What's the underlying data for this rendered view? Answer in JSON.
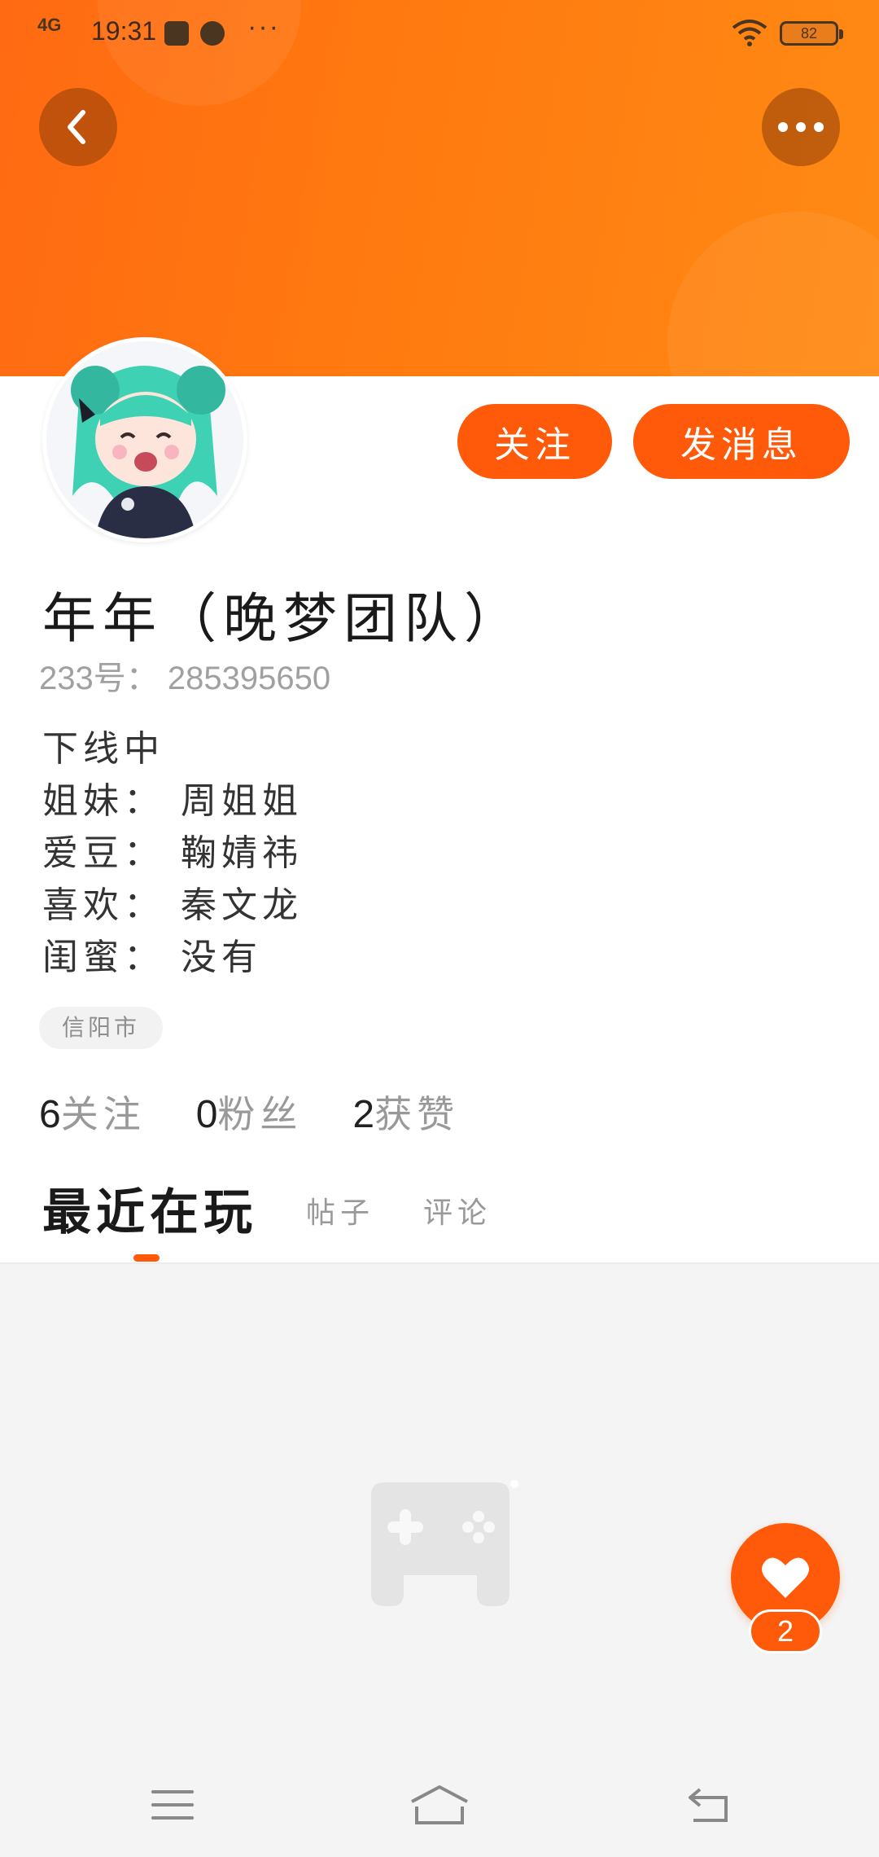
{
  "status_bar": {
    "network": "4G",
    "time": "19:31",
    "more": "···",
    "battery": "82"
  },
  "header": {
    "back_icon": "chevron-left-icon",
    "more_icon": "more-horizontal-icon"
  },
  "actions": {
    "follow_label": "关注",
    "message_label": "发消息"
  },
  "profile": {
    "name": "年年（晚梦团队）",
    "uid": "233号： 285395650",
    "bio": [
      "下线中",
      "姐妹： 周姐姐",
      "爱豆： 鞠婧祎",
      "喜欢： 秦文龙",
      "闺蜜： 没有"
    ],
    "location": "信阳市"
  },
  "stats": [
    {
      "num": "6",
      "label": "关注"
    },
    {
      "num": "0",
      "label": "粉丝"
    },
    {
      "num": "2",
      "label": "获赞"
    }
  ],
  "tabs": {
    "active": "最近在玩",
    "posts": "帖子",
    "comments": "评论"
  },
  "like": {
    "count": "2",
    "icon": "heart-icon"
  },
  "colors": {
    "accent": "#ff5a0a",
    "banner": "#ff7a10"
  },
  "nav": {
    "menu_icon": "menu-icon",
    "home_icon": "home-icon",
    "back_icon": "back-icon"
  }
}
